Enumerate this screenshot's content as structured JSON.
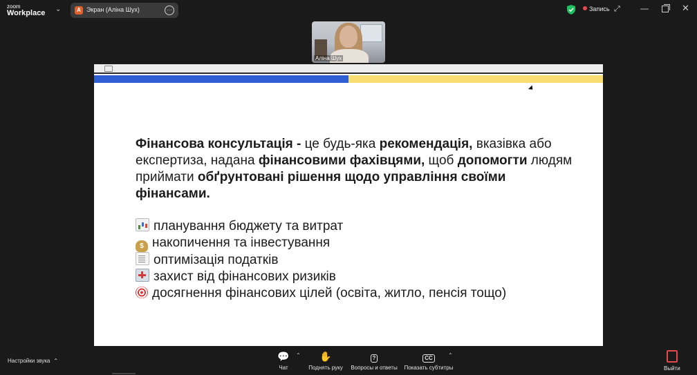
{
  "app": {
    "logo_line1": "zoom",
    "logo_line2": "Workplace"
  },
  "share_tab": {
    "avatar_letter": "A",
    "title": "Экран (Аліна Шух)"
  },
  "status": {
    "recording_label": "Запись"
  },
  "participant": {
    "name": "Аліна Шух"
  },
  "slide": {
    "paragraph": [
      {
        "text": "Фінансова консультація - ",
        "bold": true
      },
      {
        "text": "це будь-яка ",
        "bold": false
      },
      {
        "text": "рекомендація,",
        "bold": true
      },
      {
        "text": " вказівка або експертиза, надана ",
        "bold": false
      },
      {
        "text": "фінансовими фахівцями,",
        "bold": true
      },
      {
        "text": " щоб ",
        "bold": false
      },
      {
        "text": "допомогти",
        "bold": true
      },
      {
        "text": " людям приймати ",
        "bold": false
      },
      {
        "text": "обґрунтовані рішення щодо управління своїми фінансами.",
        "bold": true
      }
    ],
    "bullets": [
      {
        "icon": "bar-chart-icon",
        "text": "планування бюджету та витрат"
      },
      {
        "icon": "money-bag-icon",
        "text": "накопичення та інвестування"
      },
      {
        "icon": "receipt-icon",
        "text": "оптимізація податків"
      },
      {
        "icon": "hospital-icon",
        "text": "захист від фінансових ризиків"
      },
      {
        "icon": "target-icon",
        "text": "досягнення фінансових цілей (освіта, житло, пенсія тощо)"
      }
    ]
  },
  "bottom": {
    "audio_settings": "Настройки звука",
    "chat": "Чат",
    "raise_hand": "Поднять руку",
    "qa": "Вопросы и ответы",
    "captions": "Показать субтитры",
    "captions_icon_text": "CC",
    "leave": "Выйти"
  },
  "colors": {
    "accent_blue": "#2f5fd3",
    "accent_yellow": "#f7dd72",
    "record_red": "#e5484d",
    "shield_green": "#1fbf5f"
  }
}
